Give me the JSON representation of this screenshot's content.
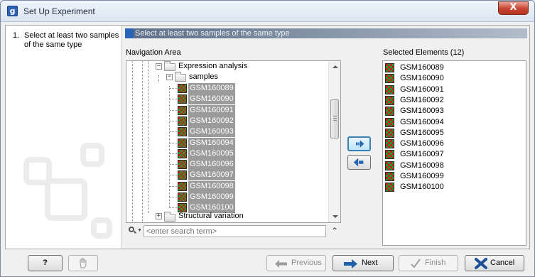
{
  "window": {
    "title": "Set Up Experiment",
    "app_icon": "g",
    "close_symbol": "X"
  },
  "steps": [
    {
      "number": "1.",
      "label": "Select at least two samples of the same type"
    }
  ],
  "main": {
    "header": "Select at least two samples of the same type",
    "navigation_label": "Navigation Area",
    "selected_label": "Selected Elements (12)"
  },
  "tree": {
    "expression_folder": "Expression analysis",
    "samples_folder": "samples",
    "structural_folder": "Structural variation",
    "samples": [
      "GSM160089",
      "GSM160090",
      "GSM160091",
      "GSM160092",
      "GSM160093",
      "GSM160094",
      "GSM160095",
      "GSM160096",
      "GSM160097",
      "GSM160098",
      "GSM160099",
      "GSM160100"
    ]
  },
  "search": {
    "placeholder": "<enter search term>"
  },
  "selected": [
    "GSM160089",
    "GSM160090",
    "GSM160091",
    "GSM160092",
    "GSM160093",
    "GSM160094",
    "GSM160095",
    "GSM160096",
    "GSM160097",
    "GSM160098",
    "GSM160099",
    "GSM160100"
  ],
  "footer": {
    "help": "?",
    "previous": "Previous",
    "next": "Next",
    "finish": "Finish",
    "cancel": "Cancel"
  },
  "icons": {
    "sample": "microarray-sample-icon",
    "folder": "folder-icon",
    "move_right": "arrow-right-icon",
    "move_left": "arrow-left-icon"
  },
  "colors": {
    "header_gradient_start": "#5c6e86",
    "selection_gray": "#9b9b9b",
    "close_red": "#c7432f",
    "accent_blue": "#2a64b6"
  }
}
